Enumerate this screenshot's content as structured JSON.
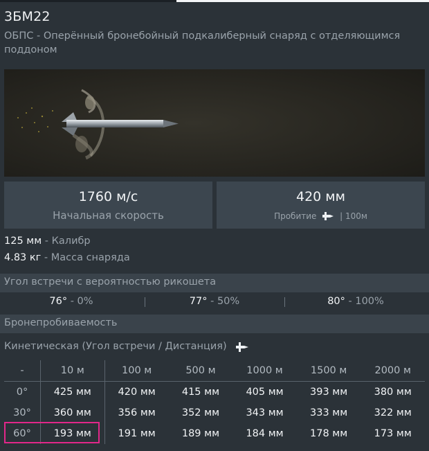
{
  "shell": {
    "title": "3БМ22",
    "subtitle": "ОБПС - Оперённый бронебойный подкалиберный снаряд с отделяющимся поддоном"
  },
  "stats": {
    "velocity_value": "1760 м/с",
    "velocity_label": "Начальная скорость",
    "penetration_value": "420 мм",
    "penetration_label_prefix": "Пробитие",
    "penetration_label_suffix": "| 100м"
  },
  "specs": {
    "caliber_value": "125 мм",
    "caliber_label": "- Калибр",
    "mass_value": "4.83 кг",
    "mass_label": "- Масса снаряда"
  },
  "ricochet": {
    "header": "Угол встречи с вероятностью рикошета",
    "cells": [
      {
        "angle": "76°",
        "chance": "- 0%"
      },
      {
        "angle": "77°",
        "chance": "- 50%"
      },
      {
        "angle": "80°",
        "chance": "- 100%"
      }
    ]
  },
  "armor": {
    "header": "Бронепробиваемость",
    "kinetic_label": "Кинетическая (Угол встречи / Дистанция)",
    "columns": [
      "-",
      "10 м",
      "100 м",
      "500 м",
      "1000 м",
      "1500 м",
      "2000 м"
    ],
    "rows": [
      {
        "angle": "0°",
        "values": [
          "425 мм",
          "420 мм",
          "415 мм",
          "405 мм",
          "393 мм",
          "380 мм"
        ]
      },
      {
        "angle": "30°",
        "values": [
          "360 мм",
          "356 мм",
          "352 мм",
          "343 мм",
          "333 мм",
          "322 мм"
        ]
      },
      {
        "angle": "60°",
        "values": [
          "193 мм",
          "191 мм",
          "189 мм",
          "184 мм",
          "178 мм",
          "173 мм"
        ]
      }
    ]
  },
  "colors": {
    "highlight": "#e3278a",
    "panel": "#2b3238",
    "stat_box": "#3c464f"
  },
  "icons": [
    "penetration-icon",
    "shell-render-image"
  ]
}
